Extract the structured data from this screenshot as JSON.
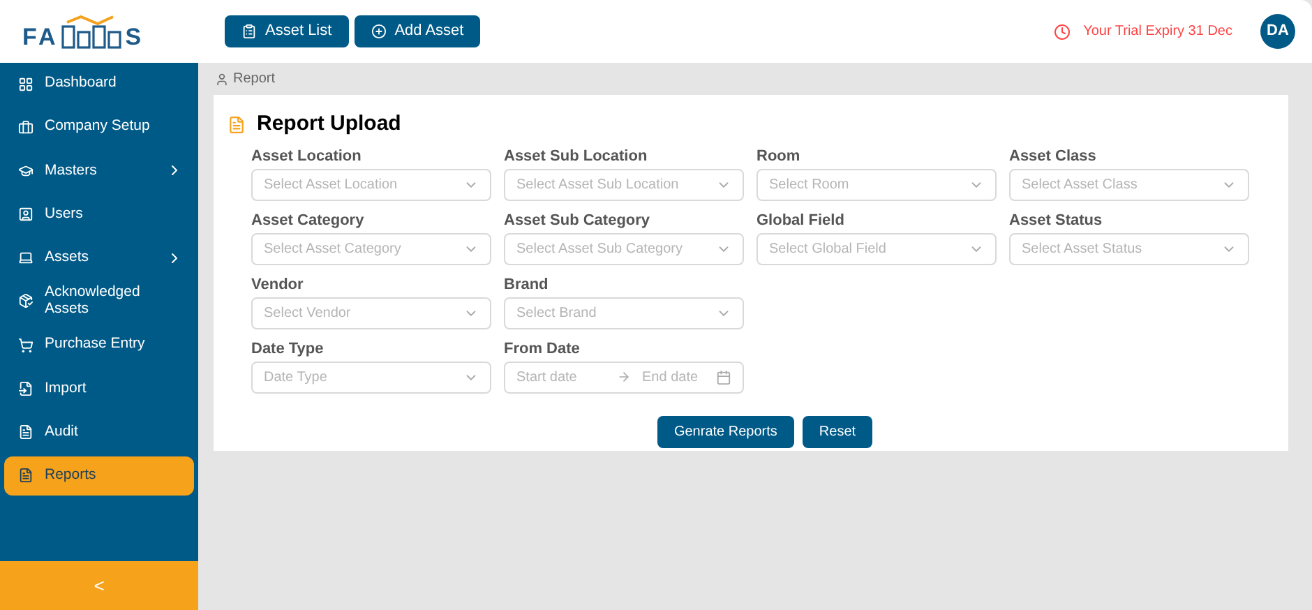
{
  "logo": {
    "left": "FA",
    "right": "S"
  },
  "header": {
    "buttons": [
      {
        "label": "Asset List",
        "kind": "list"
      },
      {
        "label": "Add Asset",
        "kind": "add"
      }
    ],
    "trial": "Your Trial Expiry 31 Dec",
    "avatar": "DA"
  },
  "sidebar": {
    "items": [
      {
        "label": "Dashboard",
        "selected": false,
        "has_submenu": false
      },
      {
        "label": "Company Setup",
        "selected": false,
        "has_submenu": false
      },
      {
        "label": "Masters",
        "selected": false,
        "has_submenu": true
      },
      {
        "label": "Users",
        "selected": false,
        "has_submenu": false
      },
      {
        "label": "Assets",
        "selected": false,
        "has_submenu": true
      },
      {
        "label": "Acknowledged Assets",
        "selected": false,
        "has_submenu": false
      },
      {
        "label": "Purchase Entry",
        "selected": false,
        "has_submenu": false
      },
      {
        "label": "Import",
        "selected": false,
        "has_submenu": false
      },
      {
        "label": "Audit",
        "selected": false,
        "has_submenu": false
      },
      {
        "label": "Reports",
        "selected": true,
        "has_submenu": false
      }
    ],
    "collapse": "<"
  },
  "breadcrumb": "Report",
  "card": {
    "title": "Report Upload",
    "rows": [
      [
        {
          "kind": "select",
          "label": "Asset Location",
          "placeholder": "Select Asset Location"
        },
        {
          "kind": "select",
          "label": "Asset Sub Location",
          "placeholder": "Select Asset Sub Location"
        },
        {
          "kind": "select",
          "label": "Room",
          "placeholder": "Select Room"
        },
        {
          "kind": "select",
          "label": "Asset Class",
          "placeholder": "Select Asset Class"
        }
      ],
      [
        {
          "kind": "select",
          "label": "Asset Category",
          "placeholder": "Select Asset Category"
        },
        {
          "kind": "select",
          "label": "Asset Sub Category",
          "placeholder": "Select Asset Sub Category"
        },
        {
          "kind": "select",
          "label": "Global Field",
          "placeholder": "Select Global Field"
        },
        {
          "kind": "select",
          "label": "Asset Status",
          "placeholder": "Select Asset Status"
        }
      ],
      [
        {
          "kind": "select",
          "label": "Vendor",
          "placeholder": "Select Vendor"
        },
        {
          "kind": "select",
          "label": "Brand",
          "placeholder": "Select Brand"
        }
      ],
      [
        {
          "kind": "select",
          "label": "Date Type",
          "placeholder": "Date Type"
        },
        {
          "kind": "daterange",
          "label": "From Date",
          "start_placeholder": "Start date",
          "end_placeholder": "End date"
        }
      ]
    ],
    "buttons": [
      "Genrate Reports",
      "Reset"
    ]
  }
}
